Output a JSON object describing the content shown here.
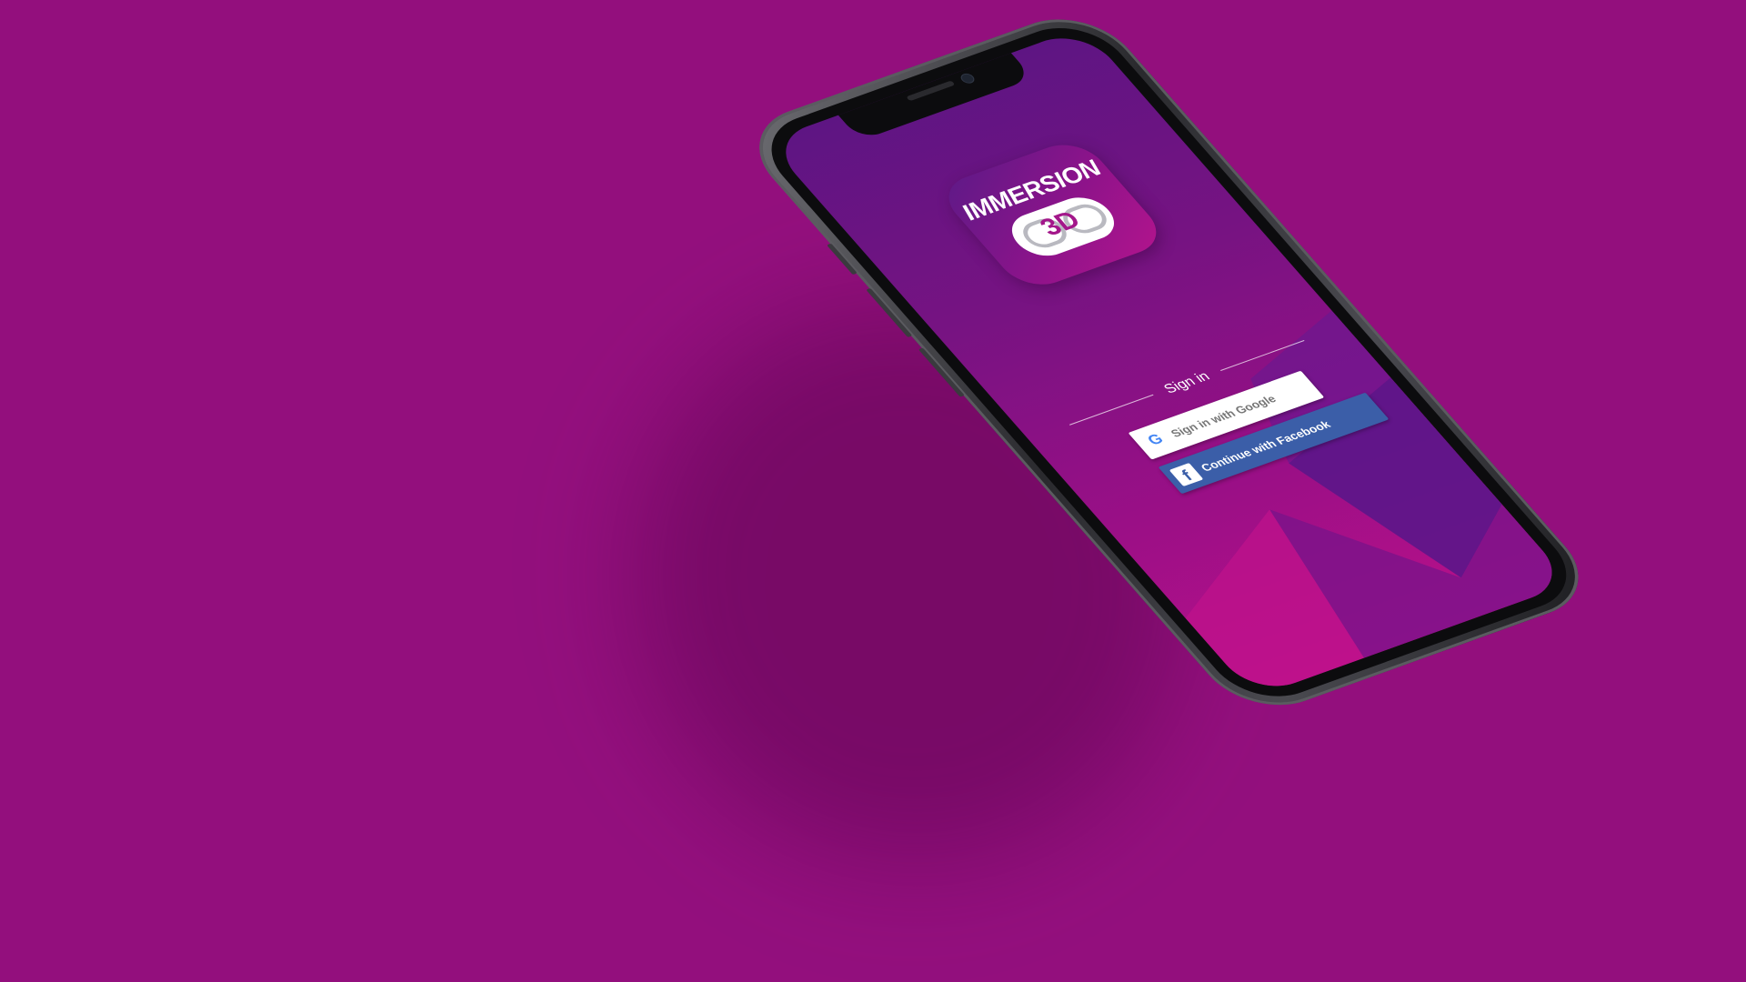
{
  "app": {
    "logo_top_text": "IMMERSION",
    "logo_bottom_text": "3D"
  },
  "signin": {
    "heading": "Sign in",
    "google_label": "Sign in with Google",
    "facebook_label": "Continue with Facebook"
  },
  "colors": {
    "background": "#930f7d",
    "google_button": "#ffffff",
    "facebook_button": "#3b5ea8"
  },
  "icons": {
    "google": "google-g-icon",
    "facebook": "facebook-f-icon"
  }
}
